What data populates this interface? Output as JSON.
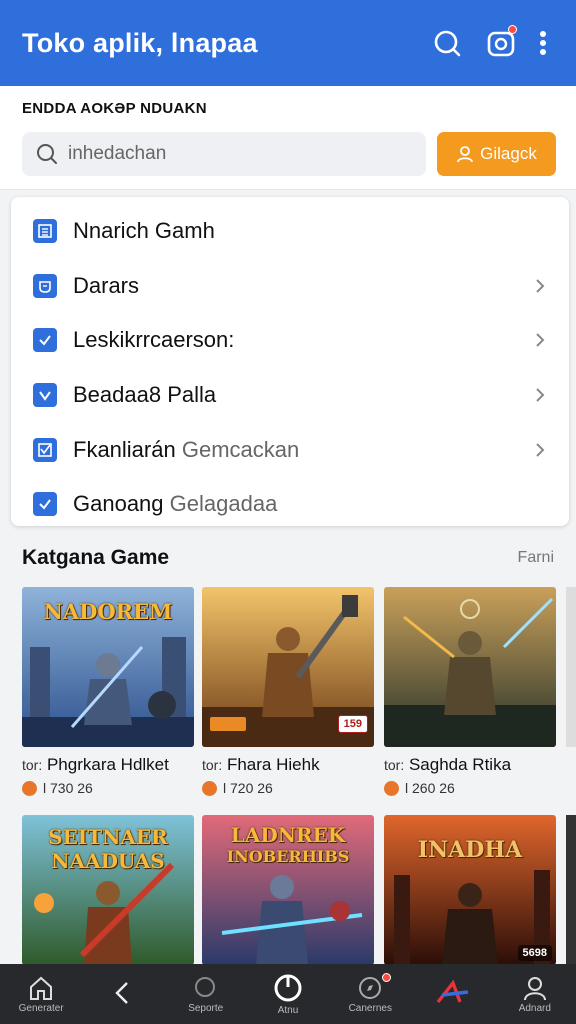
{
  "app_bar": {
    "title": "Toko aplik, lnapaa"
  },
  "search": {
    "section_label": "ENDDA AOKƏP NDUAKN",
    "placeholder": "inhedachan",
    "button_label": "Gilagck"
  },
  "menu": {
    "items": [
      {
        "label": "Nnarich Gamh",
        "sub": "",
        "icon": "list-icon",
        "chevron": false
      },
      {
        "label": "Darars",
        "sub": "",
        "icon": "cup-icon",
        "chevron": true
      },
      {
        "label": "Leskikrrcaerson:",
        "sub": "",
        "icon": "check-icon",
        "chevron": true
      },
      {
        "label": "Beadaa8 Palla",
        "sub": "",
        "icon": "shield-check-icon",
        "chevron": true
      },
      {
        "label": "Fkanliarán",
        "sub": "Gemcackan",
        "icon": "checkbox-icon",
        "chevron": true
      },
      {
        "label": "Ganoang",
        "sub": "Gelagadaa",
        "icon": "check-icon",
        "chevron": false
      }
    ]
  },
  "category": {
    "title": "Katgana Game",
    "more_label": "Farni"
  },
  "games": [
    {
      "art_title": "NADOREM",
      "art_subtitle": "",
      "prefix": "tor:",
      "name": "Phgrkara Hdlket",
      "meta": "l 730 26",
      "price": "",
      "palette": [
        "#2b4f8c",
        "#8fb3d9"
      ]
    },
    {
      "art_title": "",
      "art_subtitle": "",
      "prefix": "tor:",
      "name": "Fhara Hiehk",
      "meta": "l 720 26",
      "price": "159",
      "palette": [
        "#b8682a",
        "#f3c46a"
      ]
    },
    {
      "art_title": "",
      "art_subtitle": "",
      "prefix": "tor:",
      "name": "Saghda Rtika",
      "meta": "l 260 26",
      "price": "",
      "palette": [
        "#3a4d3a",
        "#c9a05a"
      ]
    },
    {
      "art_title": "SEITNAER",
      "art_subtitle": "NAADUAS",
      "prefix": "",
      "name": "",
      "meta": "",
      "price": "",
      "palette": [
        "#3e7a4a",
        "#e9b84b"
      ]
    },
    {
      "art_title": "LADNREK",
      "art_subtitle": "INOBERHIBS",
      "prefix": "",
      "name": "",
      "meta": "",
      "price": "",
      "palette": [
        "#3d5fa8",
        "#e26a7a"
      ]
    },
    {
      "art_title": "INADHA",
      "art_subtitle": "",
      "prefix": "",
      "name": "",
      "meta": "",
      "price": "5698",
      "palette": [
        "#5a1f12",
        "#e0662c"
      ]
    }
  ],
  "bottom_nav": [
    {
      "label": "Generater",
      "icon": "home-icon"
    },
    {
      "label": "",
      "icon": "back-icon"
    },
    {
      "label": "Seporte",
      "icon": "search-icon"
    },
    {
      "label": "Atnu",
      "icon": "power-icon"
    },
    {
      "label": "Canernes",
      "icon": "compass-icon"
    },
    {
      "label": "",
      "icon": "logo-icon"
    },
    {
      "label": "Adnard",
      "icon": "user-icon"
    }
  ],
  "colors": {
    "primary": "#2f6fdc",
    "accent": "#f39a1f",
    "nav_bg": "#27292d"
  }
}
